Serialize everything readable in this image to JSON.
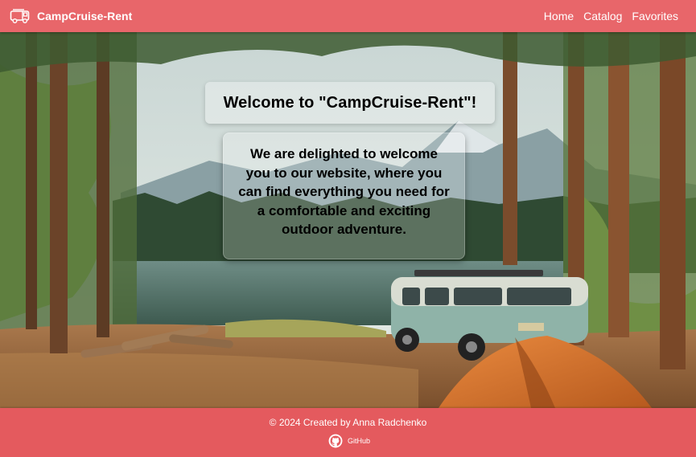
{
  "header": {
    "brand": "CampCruise-Rent",
    "brand_icon": "camper-van-icon",
    "nav": [
      {
        "label": "Home"
      },
      {
        "label": "Catalog"
      },
      {
        "label": "Favorites"
      }
    ]
  },
  "hero": {
    "title": "Welcome to \"CampCruise-Rent\"!",
    "message": "We are delighted to welcome you to our website, where you can find everything you need for a comfortable and exciting outdoor adventure."
  },
  "footer": {
    "copyright": "© 2024 Created by Anna Radchenko",
    "github_label": "GitHub",
    "github_icon": "github-icon"
  },
  "colors": {
    "header_bg": "#e8666a",
    "footer_bg": "#e45a5e",
    "text_light": "#ffffff"
  }
}
